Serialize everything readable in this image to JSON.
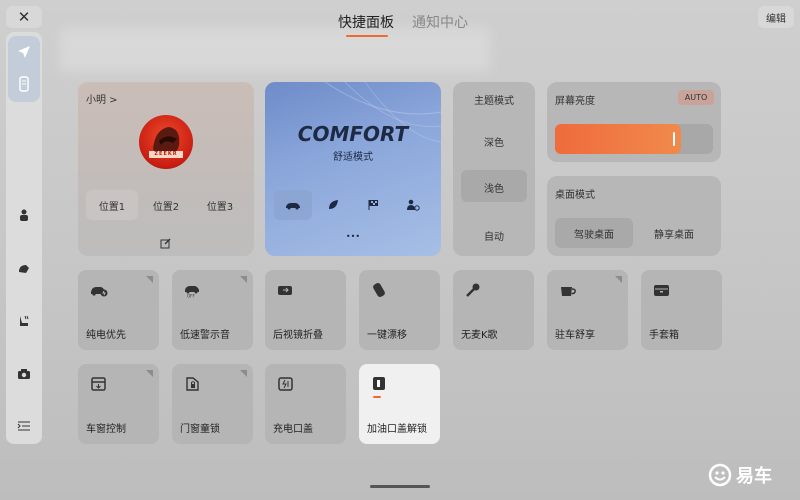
{
  "header": {
    "close_icon": "close-icon",
    "tabs": [
      {
        "label": "快捷面板",
        "active": true
      },
      {
        "label": "通知中心",
        "active": false
      }
    ],
    "edit_label": "编辑",
    "accent": "#ee6a2e"
  },
  "rail": {
    "items": [
      "send-icon",
      "phone-icon",
      "driver-icon",
      "steering-icon",
      "seat-icon",
      "camera-icon",
      "collapse-icon"
    ]
  },
  "profile": {
    "name": "小明 >",
    "avatar_text": "ZEEKR",
    "positions": [
      "位置1",
      "位置2",
      "位置3"
    ],
    "selected_position": "位置1"
  },
  "drive_mode": {
    "title": "COMFORT",
    "subtitle": "舒适模式",
    "more": "•••"
  },
  "theme": {
    "title": "主题模式",
    "options": [
      "深色",
      "浅色",
      "自动"
    ],
    "selected": "浅色"
  },
  "brightness": {
    "title": "屏幕亮度",
    "auto_label": "AUTO",
    "level_percent": 80
  },
  "desktop": {
    "title": "桌面模式",
    "options": [
      "驾驶桌面",
      "静享桌面"
    ],
    "selected": "驾驶桌面"
  },
  "tiles": [
    {
      "label": "纯电优先",
      "icon": "ev-car-icon",
      "corner": true
    },
    {
      "label": "低速警示音",
      "icon": "speaker-car-icon",
      "corner": true
    },
    {
      "label": "后视镜折叠",
      "icon": "mirror-fold-icon",
      "corner": false
    },
    {
      "label": "一键漂移",
      "icon": "drift-icon",
      "corner": false
    },
    {
      "label": "无麦K歌",
      "icon": "microphone-icon",
      "corner": false
    },
    {
      "label": "驻车舒享",
      "icon": "coffee-cup-icon",
      "corner": true
    },
    {
      "label": "手套箱",
      "icon": "glovebox-icon",
      "corner": false
    },
    {
      "label": "车窗控制",
      "icon": "window-icon",
      "corner": true
    },
    {
      "label": "门窗童锁",
      "icon": "child-lock-icon",
      "corner": true
    },
    {
      "label": "充电口盖",
      "icon": "charge-port-icon",
      "corner": false
    },
    {
      "label": "加油口盖解锁",
      "icon": "fuel-cap-icon",
      "corner": false,
      "active": true
    }
  ],
  "watermark": "易车"
}
